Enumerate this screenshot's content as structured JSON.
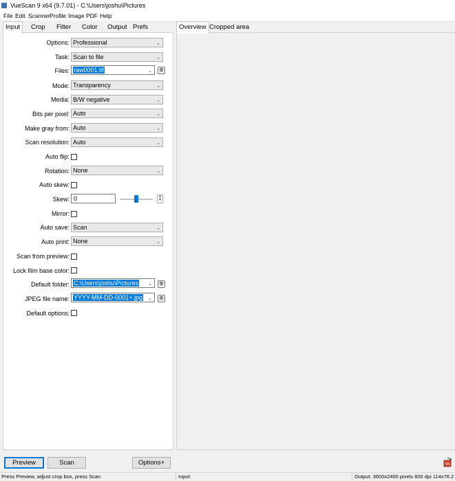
{
  "window": {
    "title": "VueScan 9 x64 (9.7.01) - C:\\Users\\joshu\\Pictures"
  },
  "menu": [
    "File",
    "Edit",
    "Scanner",
    "Profile",
    "Image",
    "PDF",
    "Help"
  ],
  "left_tabs": [
    "Input",
    "Crop",
    "Filter",
    "Color",
    "Output",
    "Prefs"
  ],
  "right_tabs": [
    "Overview",
    "Cropped area"
  ],
  "form": {
    "options": {
      "label": "Options:",
      "value": "Professional"
    },
    "task": {
      "label": "Task:",
      "value": "Scan to file"
    },
    "files": {
      "label": "Files:",
      "value": "raw0001.tif"
    },
    "mode": {
      "label": "Mode:",
      "value": "Transparency"
    },
    "media": {
      "label": "Media:",
      "value": "B/W negative"
    },
    "bits_per_pixel": {
      "label": "Bits per pixel:",
      "value": "Auto"
    },
    "make_gray_from": {
      "label": "Make gray from:",
      "value": "Auto"
    },
    "scan_resolution": {
      "label": "Scan resolution:",
      "value": "Auto"
    },
    "auto_flip": {
      "label": "Auto flip:",
      "checked": false
    },
    "rotation": {
      "label": "Rotation:",
      "value": "None"
    },
    "auto_skew": {
      "label": "Auto skew:",
      "checked": false
    },
    "skew": {
      "label": "Skew:",
      "value": "0"
    },
    "mirror": {
      "label": "Mirror:",
      "checked": false
    },
    "auto_save": {
      "label": "Auto save:",
      "value": "Scan"
    },
    "auto_print": {
      "label": "Auto print:",
      "value": "None"
    },
    "scan_from_preview": {
      "label": "Scan from preview:",
      "checked": false
    },
    "lock_film_base_color": {
      "label": "Lock film base color:",
      "checked": false
    },
    "default_folder": {
      "label": "Default folder:",
      "value": "C:\\Users\\joshu\\Pictures"
    },
    "jpeg_file_name": {
      "label": "JPEG file name:",
      "value": "YYYY-MM-DD-0001+.jpg"
    },
    "default_options": {
      "label": "Default options:",
      "checked": false
    }
  },
  "buttons": {
    "preview": "Preview",
    "scan": "Scan",
    "options": "Options+"
  },
  "status": {
    "hint": "Press Preview, adjust crop box, press Scan",
    "input": "Input:",
    "output": "Output: 3600x2400 pixels 800 dpi 114x76.2 mm 2.5"
  },
  "colors": {
    "accent": "#0078d7",
    "panel": "#ffffff",
    "window": "#f0f0f0"
  }
}
